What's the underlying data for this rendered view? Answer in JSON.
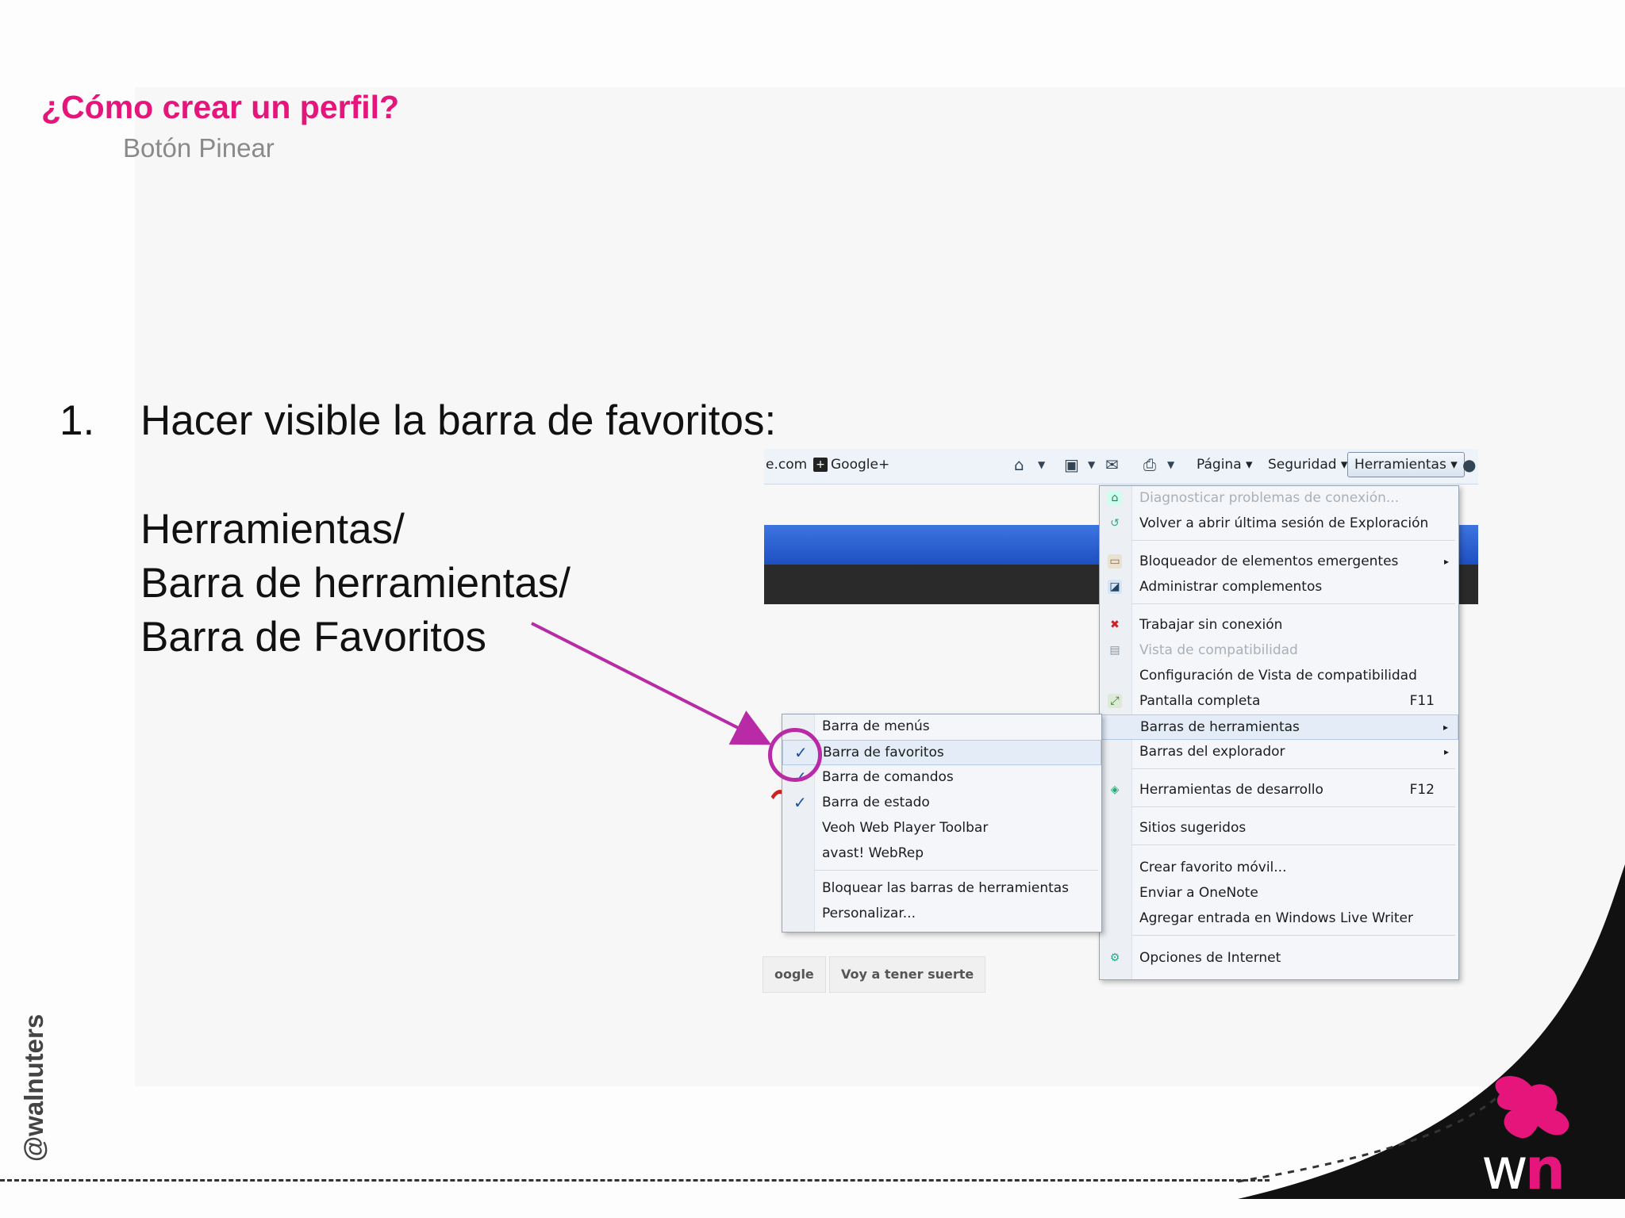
{
  "slide": {
    "title": "¿Cómo crear un perfil?",
    "subtitle": "Botón Pinear",
    "step_number": "1.",
    "step_text": "Hacer visible la barra de favoritos:",
    "path_lines": [
      "Herramientas/",
      "Barra de herramientas/",
      "Barra de Favoritos"
    ],
    "handle": "@walnuters",
    "logo_w": "w",
    "logo_n": "n"
  },
  "browser": {
    "url_fragment": "e.com",
    "google_plus": "Google+",
    "pagina": "Página ▾",
    "seguridad": "Seguridad ▾",
    "herramientas": "Herramientas ▾",
    "google_button": "oogle",
    "lucky_button": "Voy a tener suerte"
  },
  "tools_menu": {
    "items": [
      {
        "label": "Diagnosticar problemas de conexión...",
        "disabled": true
      },
      {
        "label": "Volver a abrir última sesión de Exploración"
      },
      {
        "label": "Bloqueador de elementos emergentes",
        "submenu": "▸"
      },
      {
        "label": "Administrar complementos"
      },
      {
        "label": "Trabajar sin conexión"
      },
      {
        "label": "Vista de compatibilidad",
        "disabled": true
      },
      {
        "label": "Configuración de Vista de compatibilidad"
      },
      {
        "label": "Pantalla completa",
        "shortcut": "F11"
      },
      {
        "label": "Barras de herramientas",
        "submenu": "▸"
      },
      {
        "label": "Barras del explorador",
        "submenu": "▸"
      },
      {
        "label": "Herramientas de desarrollo",
        "shortcut": "F12"
      },
      {
        "label": "Sitios sugeridos"
      },
      {
        "label": "Crear favorito móvil..."
      },
      {
        "label": "Enviar a OneNote"
      },
      {
        "label": "Agregar entrada en Windows Live Writer"
      },
      {
        "label": "Opciones de Internet"
      }
    ]
  },
  "toolbars_submenu": {
    "check": "✓",
    "items": [
      {
        "label": "Barra de menús",
        "checked": false
      },
      {
        "label": "Barra de favoritos",
        "checked": true
      },
      {
        "label": "Barra de comandos",
        "checked": true
      },
      {
        "label": "Barra de estado",
        "checked": true
      },
      {
        "label": "Veoh Web Player Toolbar",
        "checked": false
      },
      {
        "label": "avast! WebRep",
        "checked": false
      },
      {
        "label": "Bloquear las barras de herramientas",
        "checked": false
      },
      {
        "label": "Personalizar...",
        "checked": false
      }
    ]
  },
  "colors": {
    "accent": "#e6157b",
    "annotation": "#b82aa6"
  }
}
